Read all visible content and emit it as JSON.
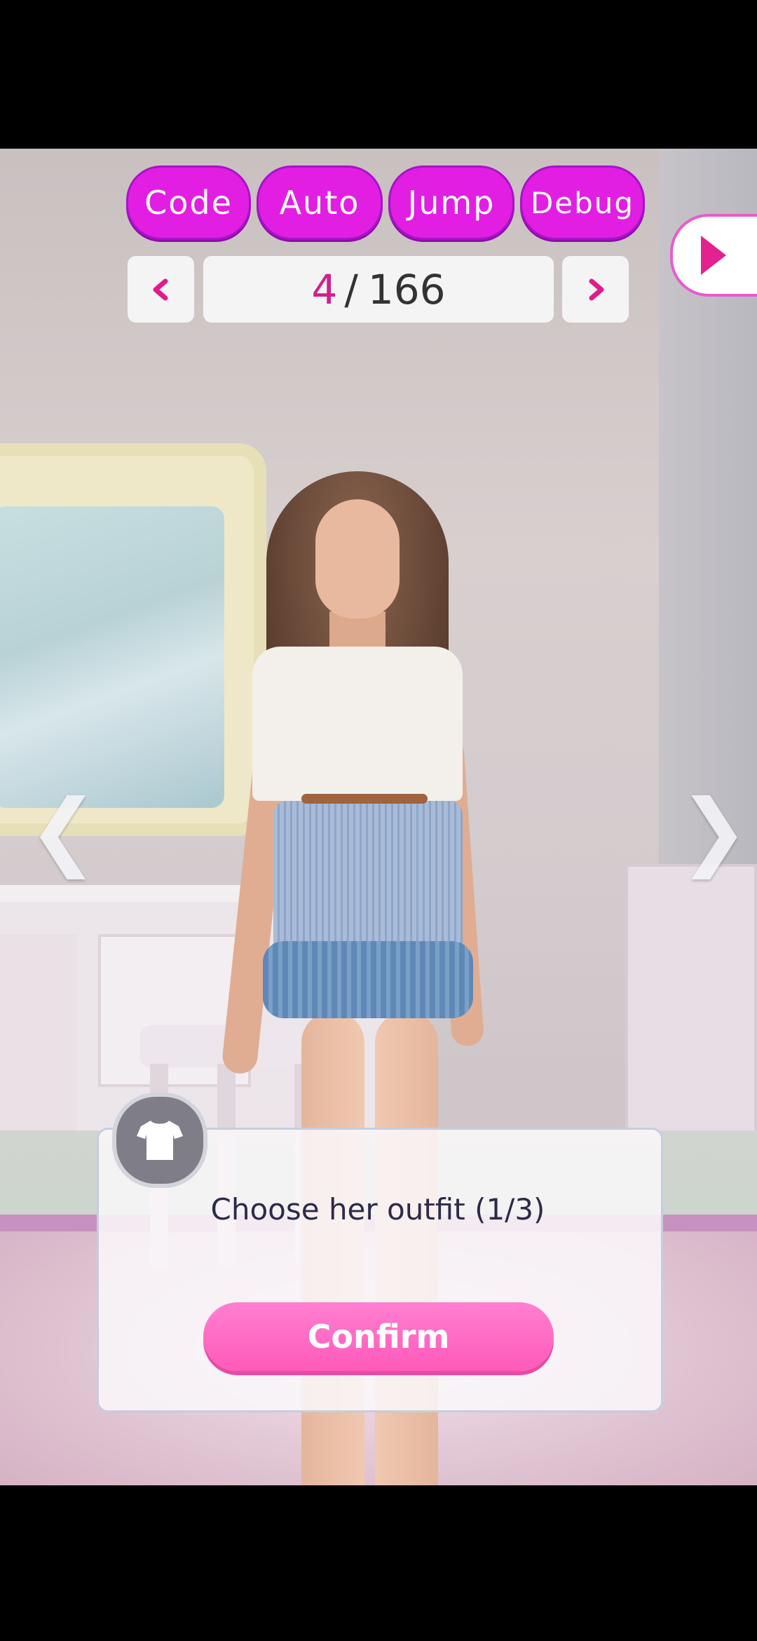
{
  "debug_bar": {
    "code_label": "Code",
    "auto_label": "Auto",
    "jump_label": "Jump",
    "debug_label": "Debug"
  },
  "pager": {
    "current": "4",
    "separator": "/",
    "total": "166",
    "prev_icon": "chevron-left-icon",
    "next_icon": "chevron-right-icon"
  },
  "side_tab": {
    "icon": "play-arrow-icon"
  },
  "carousel": {
    "left_glyph": "❮",
    "right_glyph": "❯"
  },
  "dialog": {
    "icon": "tshirt-icon",
    "prompt": "Choose her outfit (1/3)",
    "confirm_label": "Confirm"
  },
  "colors": {
    "pill": "#e21ee3",
    "accent_pink": "#e21a8d",
    "confirm": "#ff5ab9"
  }
}
